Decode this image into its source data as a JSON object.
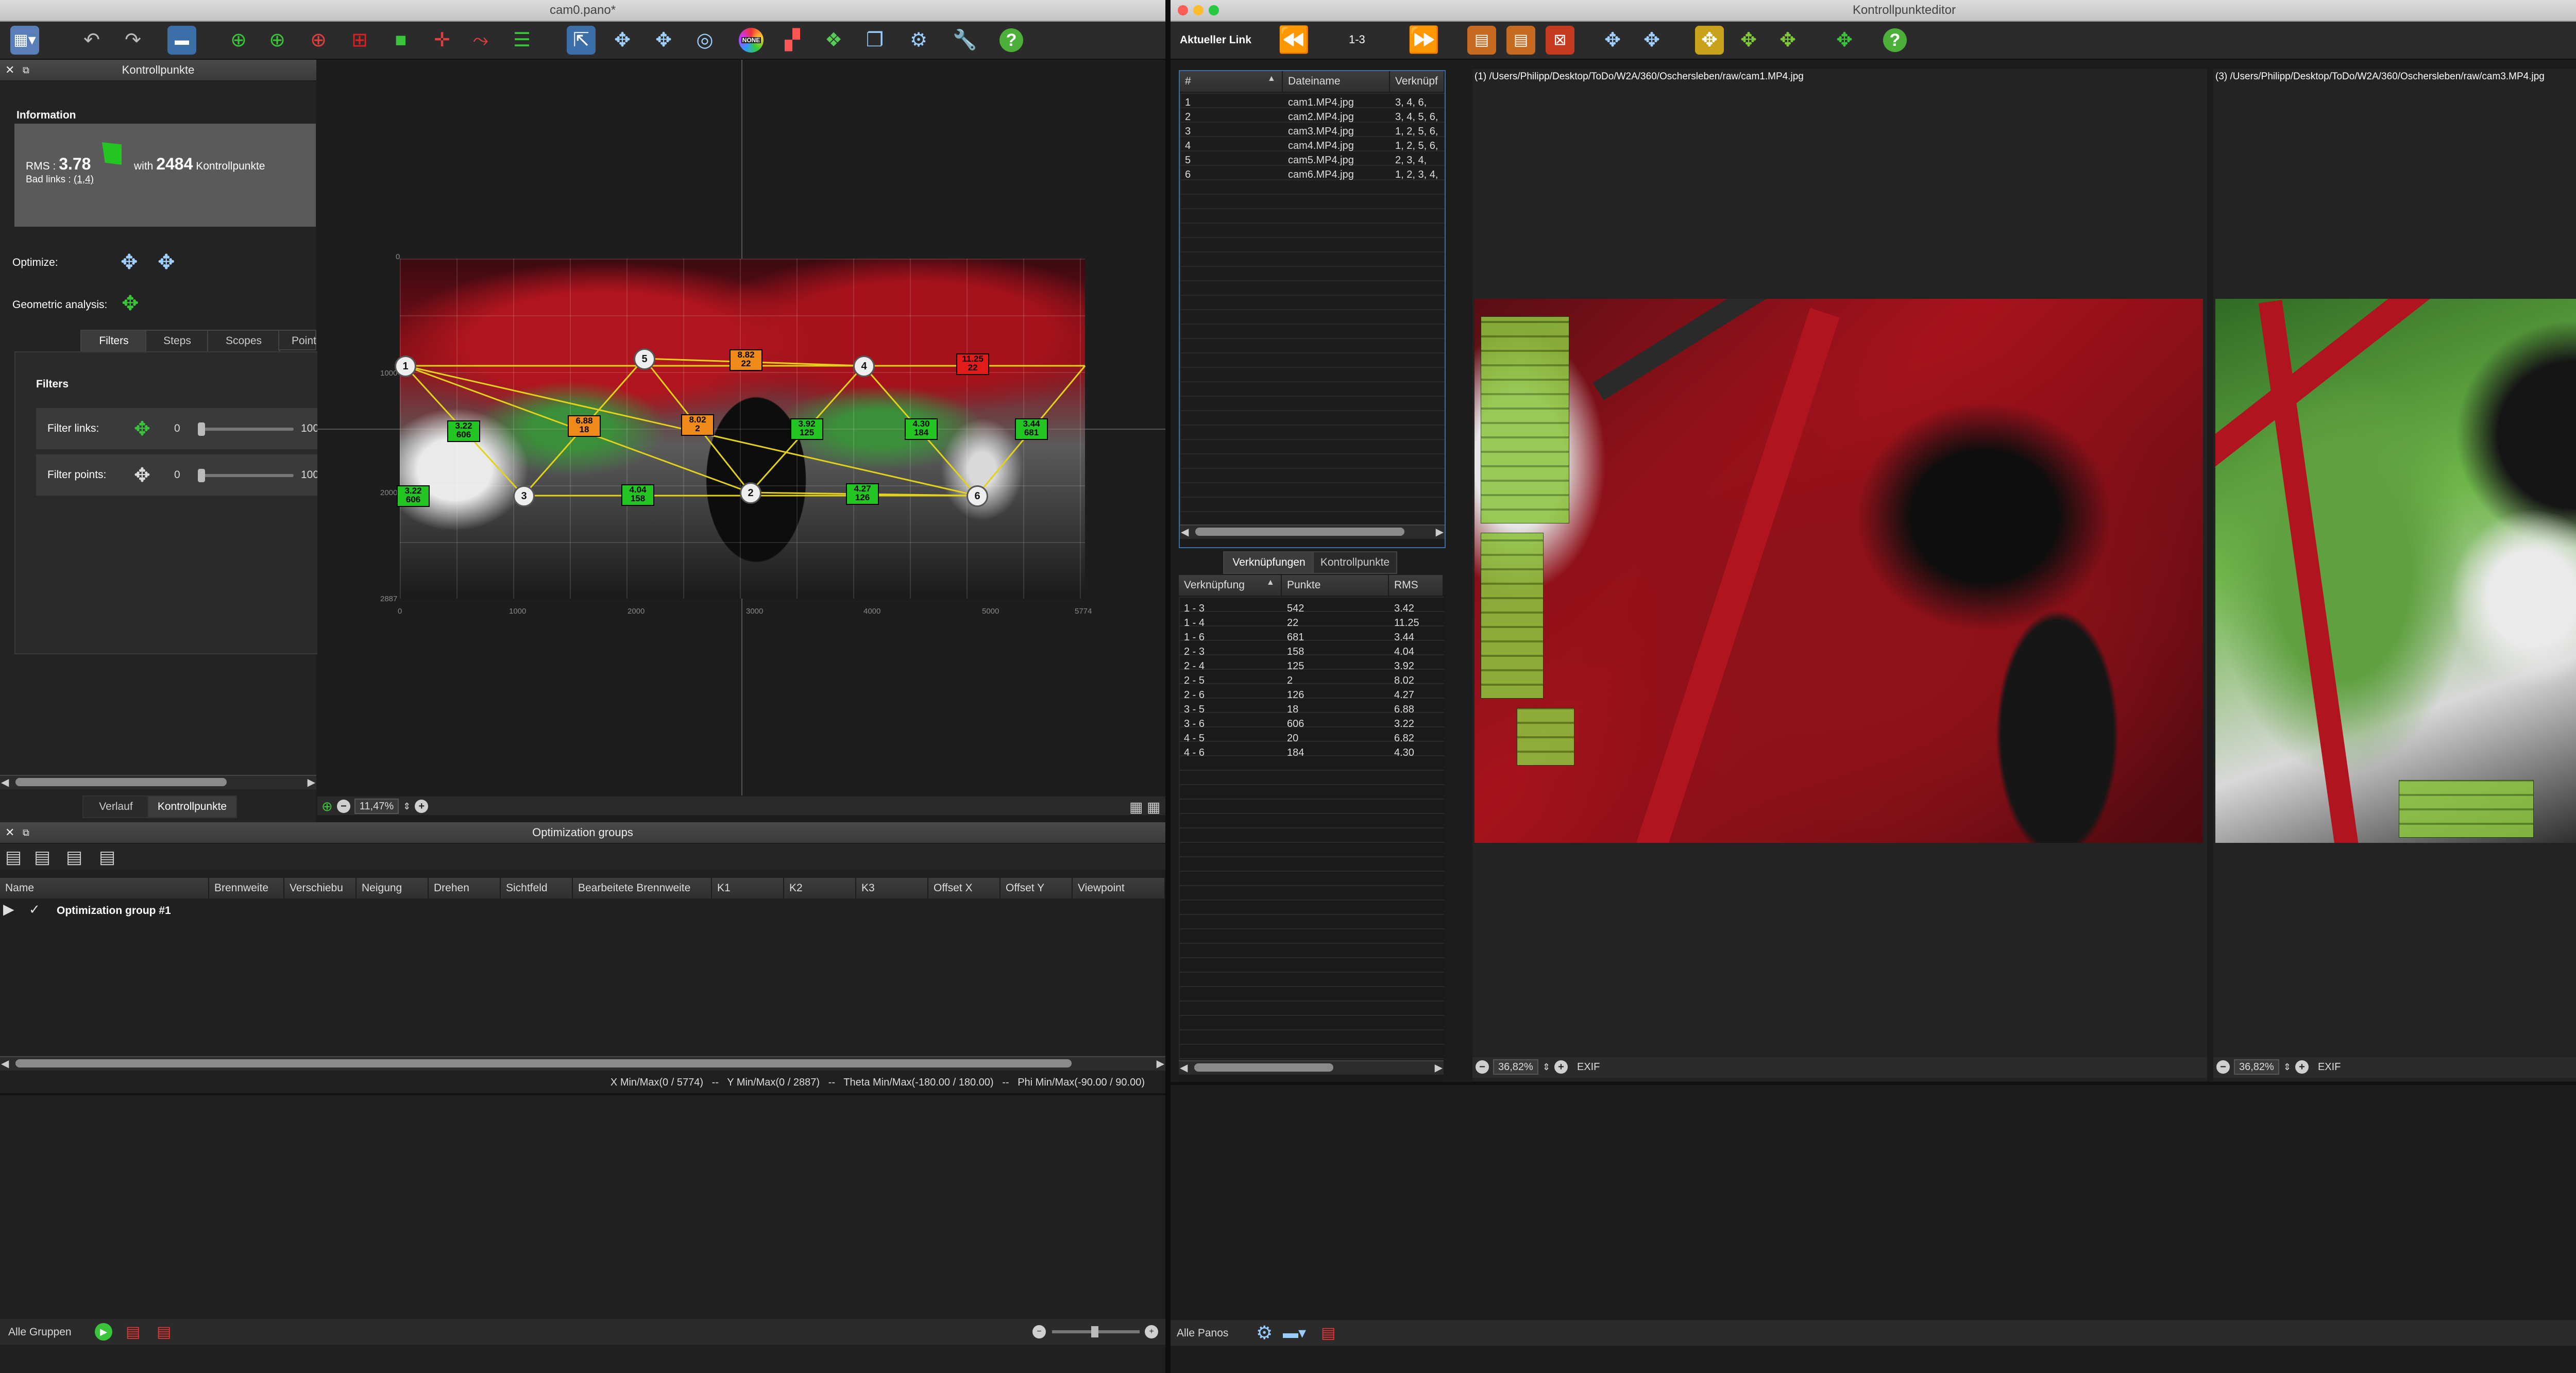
{
  "colors": {
    "accent_green": "#22c522",
    "accent_orange": "#f08b1a",
    "accent_red": "#e21b1b",
    "link_yellow": "#e3d21a",
    "panel_bg": "#202020"
  },
  "left_window": {
    "title": "cam0.pano*",
    "toolbar_icons": [
      "grid-icon",
      "undo-icon",
      "redo-icon",
      "panorama-icon",
      "target-icon",
      "target-icon",
      "target-icon",
      "select-icon",
      "crop-icon",
      "crosshair-icon",
      "line-icon",
      "layers-icon",
      "move-icon",
      "align-icon",
      "compass-icon",
      "none-icon",
      "color-icon",
      "blend-icon",
      "windows-icon",
      "settings-icon",
      "wrench-icon",
      "help-icon"
    ],
    "none_label": "NONE",
    "cp_panel": {
      "header": "Kontrollpunkte",
      "info_title": "Information",
      "rms_label": "RMS :",
      "rms_value": "3.78",
      "with_label": "with",
      "cp_count": "2484",
      "cp_label": "Kontrollpunkte",
      "bad_links_label": "Bad links :",
      "bad_links_value": "(1,4)",
      "optimize_label": "Optimize:",
      "geo_label": "Geometric analysis:",
      "tabs": [
        "Filters",
        "Steps",
        "Scopes",
        "Point"
      ],
      "filters_title": "Filters",
      "filter_links_label": "Filter links:",
      "filter_links_min": "0",
      "filter_links_max": "100",
      "filter_points_label": "Filter points:",
      "filter_points_min": "0",
      "filter_points_max": "100",
      "bottom_tabs": [
        "Verlauf",
        "Kontrollpunkte"
      ]
    },
    "viewer": {
      "y_ticks": [
        "0",
        "1000",
        "2000",
        "2887"
      ],
      "x_ticks": [
        "0",
        "1000",
        "2000",
        "3000",
        "4000",
        "5000",
        "5774"
      ],
      "zoom": "11,47%",
      "nodes": [
        "1",
        "5",
        "4",
        "3",
        "2",
        "6"
      ],
      "labels": [
        {
          "text": "8.82",
          "sub": "22",
          "color": "#f08b1a"
        },
        {
          "text": "11.25",
          "sub": "22",
          "color": "#e21b1b"
        },
        {
          "text": "3.22",
          "sub": "606",
          "color": "#22c522"
        },
        {
          "text": "6.88",
          "sub": "18",
          "color": "#f08b1a"
        },
        {
          "text": "8.02",
          "sub": "2",
          "color": "#f08b1a"
        },
        {
          "text": "3.92",
          "sub": "125",
          "color": "#22c522"
        },
        {
          "text": "4.30",
          "sub": "184",
          "color": "#22c522"
        },
        {
          "text": "3.44",
          "sub": "681",
          "color": "#22c522"
        },
        {
          "text": "3.22",
          "sub": "606",
          "color": "#22c522"
        },
        {
          "text": "4.04",
          "sub": "158",
          "color": "#22c522"
        },
        {
          "text": "4.27",
          "sub": "126",
          "color": "#22c522"
        }
      ]
    },
    "opt_groups": {
      "header": "Optimization groups",
      "columns": [
        "Name",
        "Brennweite",
        "Verschiebu",
        "Neigung",
        "Drehen",
        "Sichtfeld",
        "Bearbeitete Brennweite",
        "K1",
        "K2",
        "K3",
        "Offset X",
        "Offset Y",
        "Viewpoint"
      ],
      "row": "Optimization group #1",
      "status": "X Min/Max(0 / 5774)   --   Y Min/Max(0 / 2887)   --   Theta Min/Max(-180.00 / 180.00)   --   Phi Min/Max(-90.00 / 90.00)",
      "footer_label": "Alle Gruppen"
    }
  },
  "right_window": {
    "title": "Kontrollpunkteditor",
    "current_link_label": "Aktueller Link",
    "current_link_value": "1-3",
    "image_table": {
      "columns": [
        "#",
        "Dateiname",
        "Verknüpf"
      ],
      "rows": [
        {
          "n": "1",
          "file": "cam1.MP4.jpg",
          "links": "3, 4, 6,"
        },
        {
          "n": "2",
          "file": "cam2.MP4.jpg",
          "links": "3, 4, 5, 6,"
        },
        {
          "n": "3",
          "file": "cam3.MP4.jpg",
          "links": "1, 2, 5, 6,"
        },
        {
          "n": "4",
          "file": "cam4.MP4.jpg",
          "links": "1, 2, 5, 6,"
        },
        {
          "n": "5",
          "file": "cam5.MP4.jpg",
          "links": "2, 3, 4,"
        },
        {
          "n": "6",
          "file": "cam6.MP4.jpg",
          "links": "1, 2, 3, 4,"
        }
      ]
    },
    "link_tabs": [
      "Verknüpfungen",
      "Kontrollpunkte"
    ],
    "link_table": {
      "columns": [
        "Verknüpfung",
        "Punkte",
        "RMS"
      ],
      "rows": [
        {
          "link": "1 - 3",
          "points": "542",
          "rms": "3.42"
        },
        {
          "link": "1 - 4",
          "points": "22",
          "rms": "11.25"
        },
        {
          "link": "1 - 6",
          "points": "681",
          "rms": "3.44"
        },
        {
          "link": "2 - 3",
          "points": "158",
          "rms": "4.04"
        },
        {
          "link": "2 - 4",
          "points": "125",
          "rms": "3.92"
        },
        {
          "link": "2 - 5",
          "points": "2",
          "rms": "8.02"
        },
        {
          "link": "2 - 6",
          "points": "126",
          "rms": "4.27"
        },
        {
          "link": "3 - 5",
          "points": "18",
          "rms": "6.88"
        },
        {
          "link": "3 - 6",
          "points": "606",
          "rms": "3.22"
        },
        {
          "link": "4 - 5",
          "points": "20",
          "rms": "6.82"
        },
        {
          "link": "4 - 6",
          "points": "184",
          "rms": "4.30"
        }
      ]
    },
    "image1_path": "(1) /Users/Philipp/Desktop/ToDo/W2A/360/Oschersleben/raw/cam1.MP4.jpg",
    "image3_path": "(3) /Users/Philipp/Desktop/ToDo/W2A/360/Oschersleben/raw/cam3.MP4.jpg",
    "zoom1": "36,82%",
    "zoom3": "36,82%",
    "exif_label": "EXIF",
    "footer_label": "Alle Panos"
  }
}
